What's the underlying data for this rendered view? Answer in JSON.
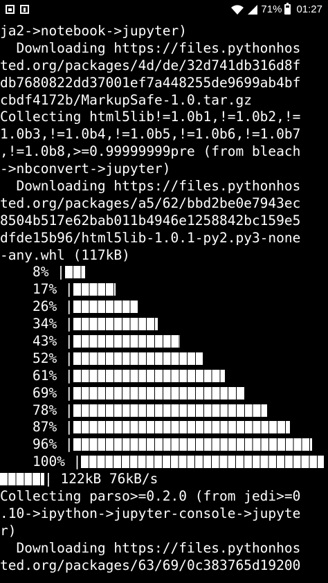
{
  "status_bar": {
    "battery_percent_label": "71%",
    "battery_level": 0.71,
    "time": "01:27",
    "left_icons": [
      "image-notification-icon",
      "message-notification-icon"
    ],
    "right_icons": [
      "wifi-icon",
      "signal-icon",
      "battery-icon"
    ]
  },
  "terminal": {
    "lines_before": [
      "ja2->notebook->jupyter)",
      "  Downloading https://files.pythonhos",
      "ted.org/packages/4d/de/32d741db316d8f",
      "db7680822dd37001ef7a448255de9699ab4bf",
      "cbdf4172b/MarkupSafe-1.0.tar.gz",
      "Collecting html5lib!=1.0b1,!=1.0b2,!=",
      "1.0b3,!=1.0b4,!=1.0b5,!=1.0b6,!=1.0b7",
      ",!=1.0b8,>=0.99999999pre (from bleach",
      "->nbconvert->jupyter)",
      "  Downloading https://files.pythonhos",
      "ted.org/packages/a5/62/bbd2be0e7943ec",
      "8504b517e62bab011b4946e1258842bc159e5",
      "dfde15b96/html5lib-1.0.1-py2.py3-none",
      "-any.whl (117kB)"
    ],
    "progress": [
      {
        "label": "    8% |",
        "fraction": 0.08
      },
      {
        "label": "    17% |",
        "fraction": 0.17
      },
      {
        "label": "    26% |",
        "fraction": 0.26
      },
      {
        "label": "    34% |",
        "fraction": 0.34
      },
      {
        "label": "    43% |",
        "fraction": 0.43
      },
      {
        "label": "    52% |",
        "fraction": 0.52
      },
      {
        "label": "    61% |",
        "fraction": 0.61
      },
      {
        "label": "    69% |",
        "fraction": 0.69
      },
      {
        "label": "    78% |",
        "fraction": 0.78
      },
      {
        "label": "    87% |",
        "fraction": 0.87
      },
      {
        "label": "    96% |",
        "fraction": 0.96
      },
      {
        "label": "    100% |",
        "fraction": 1.0
      }
    ],
    "summary": "| 122kB 76kB/s",
    "lines_after": [
      "Collecting parso>=0.2.0 (from jedi>=0",
      ".10->ipython->jupyter-console->jupyte",
      "r)",
      "  Downloading https://files.pythonhos",
      "ted.org/packages/63/69/0c383765d19200"
    ]
  }
}
